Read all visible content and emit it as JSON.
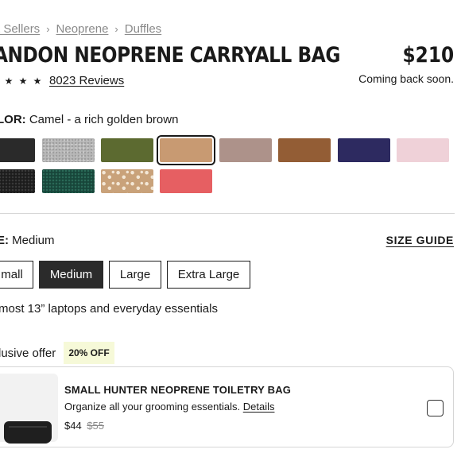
{
  "breadcrumb": {
    "items": [
      "t Sellers",
      "Neoprene",
      "Duffles"
    ],
    "separator": "›"
  },
  "product": {
    "title": "ANDON NEOPRENE CARRYALL BAG",
    "price": "$210",
    "stock_status": "Coming back soon.",
    "stars": [
      "★",
      "★",
      "★"
    ],
    "reviews_label": "8023 Reviews"
  },
  "color": {
    "label": "LOR:",
    "selected_value": "Camel - a rich golden brown",
    "swatches": [
      {
        "name": "black",
        "color": "#2a2a2a"
      },
      {
        "name": "heather-grey",
        "color": "#b8b8b8"
      },
      {
        "name": "olive",
        "color": "#5c6a30"
      },
      {
        "name": "camel",
        "color": "#c89a72",
        "selected": true
      },
      {
        "name": "mauve",
        "color": "#ad928a"
      },
      {
        "name": "rust-brown",
        "color": "#935d35"
      },
      {
        "name": "navy",
        "color": "#2d2a60"
      },
      {
        "name": "light-pink",
        "color": "#efd1d8"
      },
      {
        "name": "black-texture",
        "color": "#1c1c1c"
      },
      {
        "name": "dark-green-texture",
        "color": "#17463a"
      },
      {
        "name": "fawn-print",
        "color": "#c9a27a"
      },
      {
        "name": "coral-red",
        "color": "#e65f62"
      }
    ]
  },
  "size": {
    "label": "E:",
    "selected_value": "Medium",
    "guide_label": "SIZE GUIDE",
    "options": [
      "mall",
      "Medium",
      "Large",
      "Extra Large"
    ],
    "active_index": 1,
    "description": " most 13” laptops and everyday essentials"
  },
  "offer": {
    "label": "lusive offer",
    "badge": "20% OFF",
    "item": {
      "title": "SMALL HUNTER NEOPRENE TOILETRY BAG",
      "description": "Organize all your grooming essentials.",
      "details_link": "Details",
      "price": "$44",
      "original_price": "$55"
    }
  }
}
